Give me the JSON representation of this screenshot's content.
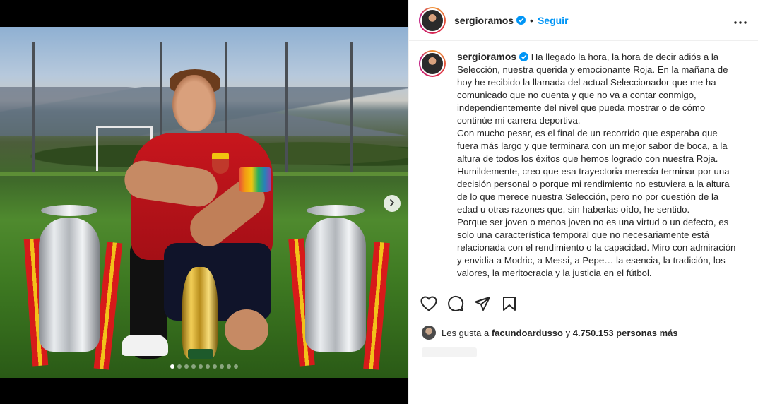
{
  "post": {
    "username": "sergioramos",
    "follow_label": "Seguir",
    "caption": "Ha llegado la hora, la hora de decir adiós a la Selección, nuestra querida y emocionante Roja. En la mañana de hoy he recibido la llamada del actual Seleccionador que me ha comunicado que no cuenta y que no va a contar conmigo, independientemente del nivel que pueda mostrar o de cómo continúe mi carrera deportiva.\nCon mucho pesar, es el final de un recorrido que esperaba que fuera más largo y que terminara con un mejor sabor de boca, a la altura de todos los éxitos que hemos logrado con nuestra Roja. Humildemente, creo que esa trayectoria merecía terminar por una decisión personal o porque mi rendimiento no estuviera a la altura de lo que merece nuestra Selección, pero no por cuestión de la edad u otras razones que, sin haberlas oído, he sentido.\nPorque ser joven o menos joven no es una virtud o un defecto, es solo una característica temporal que no necesariamente está relacionada con el rendimiento o la capacidad. Miro con admiración y envidia a Modric, a Messi, a Pepe… la esencia, la tradición, los valores, la meritocracia y la justicia en el fútbol.",
    "likes_prefix": "Les gusta a ",
    "likes_user": "facundoardusso",
    "likes_joiner": " y ",
    "likes_count": "4.750.153 personas más",
    "carousel_pages": 10,
    "carousel_active": 0
  },
  "icons": {
    "verified": "verified-badge-icon",
    "more": "more-options-icon",
    "next": "chevron-right-icon",
    "like": "heart-icon",
    "comment": "comment-icon",
    "share": "share-icon",
    "save": "bookmark-icon"
  },
  "colors": {
    "accent": "#0095f6",
    "verified": "#0095f6",
    "text": "#262626"
  }
}
